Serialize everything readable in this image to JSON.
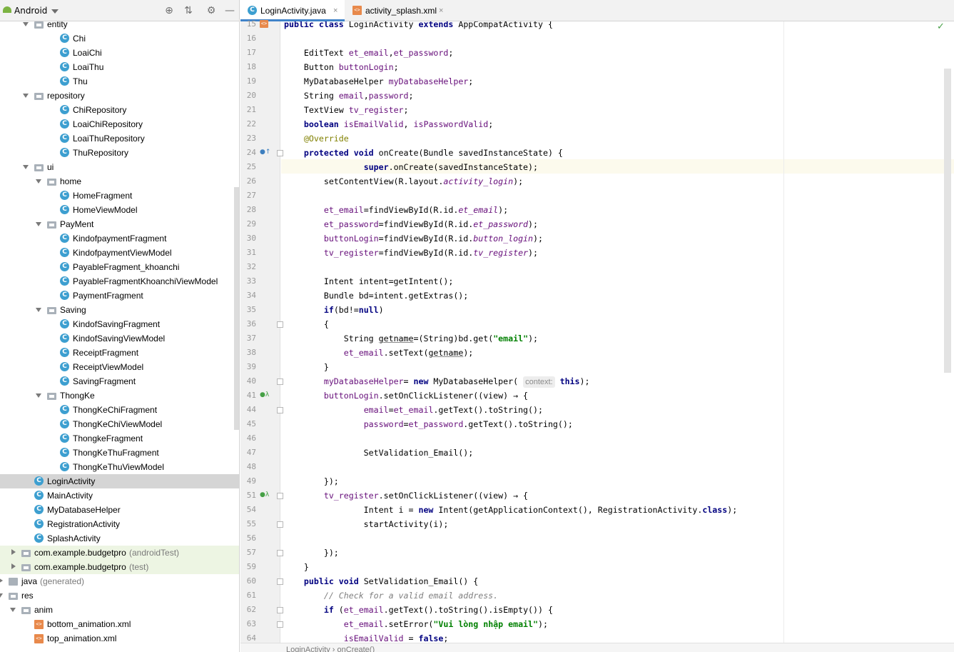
{
  "project_panel": {
    "view_label": "Android",
    "toolbar_icons": [
      "crosshair-icon",
      "collapse-all-icon",
      "gear-icon",
      "minimize-icon"
    ],
    "tree": [
      {
        "label": "entity",
        "kind": "folder",
        "expanded": true
      },
      {
        "label": "Chi",
        "kind": "class"
      },
      {
        "label": "LoaiChi",
        "kind": "class"
      },
      {
        "label": "LoaiThu",
        "kind": "class"
      },
      {
        "label": "Thu",
        "kind": "class"
      },
      {
        "label": "repository",
        "kind": "folder",
        "expanded": true
      },
      {
        "label": "ChiRepository",
        "kind": "class"
      },
      {
        "label": "LoaiChiRepository",
        "kind": "class"
      },
      {
        "label": "LoaiThuRepository",
        "kind": "class"
      },
      {
        "label": "ThuRepository",
        "kind": "class"
      },
      {
        "label": "ui",
        "kind": "folder",
        "expanded": true
      },
      {
        "label": "home",
        "kind": "folder",
        "expanded": true
      },
      {
        "label": "HomeFragment",
        "kind": "class"
      },
      {
        "label": "HomeViewModel",
        "kind": "class"
      },
      {
        "label": "PayMent",
        "kind": "folder",
        "expanded": true
      },
      {
        "label": "KindofpaymentFragment",
        "kind": "class"
      },
      {
        "label": "KindofpaymentViewModel",
        "kind": "class"
      },
      {
        "label": "PayableFragment_khoanchi",
        "kind": "class"
      },
      {
        "label": "PayableFragmentKhoanchiViewModel",
        "kind": "class"
      },
      {
        "label": "PaymentFragment",
        "kind": "class"
      },
      {
        "label": "Saving",
        "kind": "folder",
        "expanded": true
      },
      {
        "label": "KindofSavingFragment",
        "kind": "class"
      },
      {
        "label": "KindofSavingViewModel",
        "kind": "class"
      },
      {
        "label": "ReceiptFragment",
        "kind": "class"
      },
      {
        "label": "ReceiptViewModel",
        "kind": "class"
      },
      {
        "label": "SavingFragment",
        "kind": "class"
      },
      {
        "label": "ThongKe",
        "kind": "folder",
        "expanded": true
      },
      {
        "label": "ThongKeChiFragment",
        "kind": "class"
      },
      {
        "label": "ThongKeChiViewModel",
        "kind": "class"
      },
      {
        "label": "ThongkeFragment",
        "kind": "class"
      },
      {
        "label": "ThongKeThuFragment",
        "kind": "class"
      },
      {
        "label": "ThongKeThuViewModel",
        "kind": "class"
      },
      {
        "label": "LoginActivity",
        "kind": "class",
        "selected": true
      },
      {
        "label": "MainActivity",
        "kind": "class"
      },
      {
        "label": "MyDatabaseHelper",
        "kind": "class"
      },
      {
        "label": "RegistrationActivity",
        "kind": "class"
      },
      {
        "label": "SplashActivity",
        "kind": "class"
      },
      {
        "label": "com.example.budgetpro",
        "suffix": "(androidTest)",
        "kind": "folder",
        "expanded": false
      },
      {
        "label": "com.example.budgetpro",
        "suffix": "(test)",
        "kind": "folder",
        "expanded": false
      },
      {
        "label": "java",
        "suffix": "(generated)",
        "kind": "java-folder",
        "expanded": false
      },
      {
        "label": "res",
        "kind": "folder",
        "expanded": true
      },
      {
        "label": "anim",
        "kind": "folder",
        "expanded": true
      },
      {
        "label": "bottom_animation.xml",
        "kind": "xml"
      },
      {
        "label": "top_animation.xml",
        "kind": "xml"
      }
    ]
  },
  "editor": {
    "tabs": [
      {
        "label": "LoginActivity.java",
        "active": true,
        "icon": "class-icon"
      },
      {
        "label": "activity_splash.xml",
        "active": false,
        "icon": "xml-layout-icon"
      }
    ],
    "close_glyph": "×",
    "inlay_hint": "context:",
    "lines": [
      {
        "n": "15",
        "text": "public class LoginActivity extends AppCompatActivity {"
      },
      {
        "n": "16",
        "text": ""
      },
      {
        "n": "17",
        "text": "    EditText et_email,et_password;"
      },
      {
        "n": "18",
        "text": "    Button buttonLogin;"
      },
      {
        "n": "19",
        "text": "    MyDatabaseHelper myDatabaseHelper;"
      },
      {
        "n": "20",
        "text": "    String email,password;"
      },
      {
        "n": "21",
        "text": "    TextView tv_register;"
      },
      {
        "n": "22",
        "text": "    boolean isEmailValid, isPasswordValid;"
      },
      {
        "n": "23",
        "text": "    @Override"
      },
      {
        "n": "24",
        "text": "    protected void onCreate(Bundle savedInstanceState) {"
      },
      {
        "n": "25",
        "text": "                super.onCreate(savedInstanceState);"
      },
      {
        "n": "26",
        "text": "        setContentView(R.layout.activity_login);"
      },
      {
        "n": "27",
        "text": ""
      },
      {
        "n": "28",
        "text": "        et_email=findViewById(R.id.et_email);"
      },
      {
        "n": "29",
        "text": "        et_password=findViewById(R.id.et_password);"
      },
      {
        "n": "30",
        "text": "        buttonLogin=findViewById(R.id.button_login);"
      },
      {
        "n": "31",
        "text": "        tv_register=findViewById(R.id.tv_register);"
      },
      {
        "n": "32",
        "text": ""
      },
      {
        "n": "33",
        "text": "        Intent intent=getIntent();"
      },
      {
        "n": "34",
        "text": "        Bundle bd=intent.getExtras();"
      },
      {
        "n": "35",
        "text": "        if(bd!=null)"
      },
      {
        "n": "36",
        "text": "        {"
      },
      {
        "n": "37",
        "text": "            String getname=(String)bd.get(\"email\");"
      },
      {
        "n": "38",
        "text": "            et_email.setText(getname);"
      },
      {
        "n": "39",
        "text": "        }"
      },
      {
        "n": "40",
        "text": "        myDatabaseHelper= new MyDatabaseHelper( context: this);"
      },
      {
        "n": "41",
        "text": "        buttonLogin.setOnClickListener((view) → {"
      },
      {
        "n": "44",
        "text": "                email=et_email.getText().toString();"
      },
      {
        "n": "45",
        "text": "                password=et_password.getText().toString();"
      },
      {
        "n": "46",
        "text": ""
      },
      {
        "n": "47",
        "text": "                SetValidation_Email();"
      },
      {
        "n": "48",
        "text": ""
      },
      {
        "n": "49",
        "text": "        });"
      },
      {
        "n": "51",
        "text": "        tv_register.setOnClickListener((view) → {"
      },
      {
        "n": "54",
        "text": "                Intent i = new Intent(getApplicationContext(), RegistrationActivity.class);"
      },
      {
        "n": "55",
        "text": "                startActivity(i);"
      },
      {
        "n": "56",
        "text": ""
      },
      {
        "n": "57",
        "text": "        });"
      },
      {
        "n": "59",
        "text": "    }"
      },
      {
        "n": "60",
        "text": "    public void SetValidation_Email() {"
      },
      {
        "n": "61",
        "text": "        // Check for a valid email address."
      },
      {
        "n": "62",
        "text": "        if (et_email.getText().toString().isEmpty()) {"
      },
      {
        "n": "63",
        "text": "            et_email.setError(\"Vui lòng nhập email\");"
      },
      {
        "n": "64",
        "text": "            isEmailValid = false;"
      }
    ],
    "breadcrumb": "LoginActivity  ›  onCreate()"
  },
  "colors": {
    "keyword": "#000080",
    "field": "#660e7a",
    "string": "#008000",
    "annotation": "#808000",
    "comment": "#808080",
    "selection": "#d5d5d5",
    "class_icon": "#3d9fd0"
  }
}
